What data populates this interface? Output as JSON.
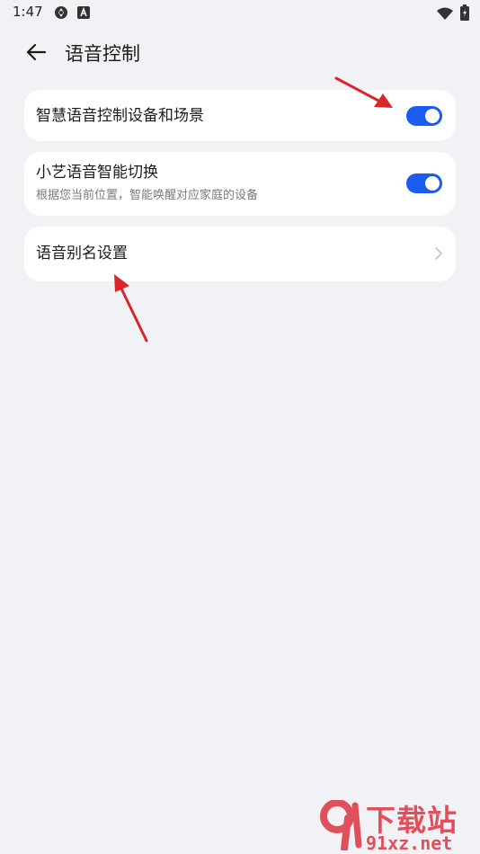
{
  "status_bar": {
    "time": "1:47",
    "left_icons": [
      "aperture-icon",
      "text-a-icon"
    ],
    "right_icons": [
      "wifi-icon",
      "battery-charging-icon"
    ]
  },
  "header": {
    "back_icon": "arrow-left-icon",
    "title": "语音控制"
  },
  "settings": [
    {
      "title": "智慧语音控制设备和场景",
      "control": "toggle",
      "enabled": true
    },
    {
      "title": "小艺语音智能切换",
      "subtitle": "根据您当前位置，智能唤醒对应家庭的设备",
      "control": "toggle",
      "enabled": true
    },
    {
      "title": "语音别名设置",
      "control": "chevron"
    }
  ],
  "watermark": {
    "top": "下载站",
    "bottom": "91xz.net"
  },
  "colors": {
    "background": "#f1f2f5",
    "card": "#ffffff",
    "toggle_on": "#1a5bf0",
    "annotation_arrow": "#d9262a",
    "watermark": "#e0505a"
  }
}
